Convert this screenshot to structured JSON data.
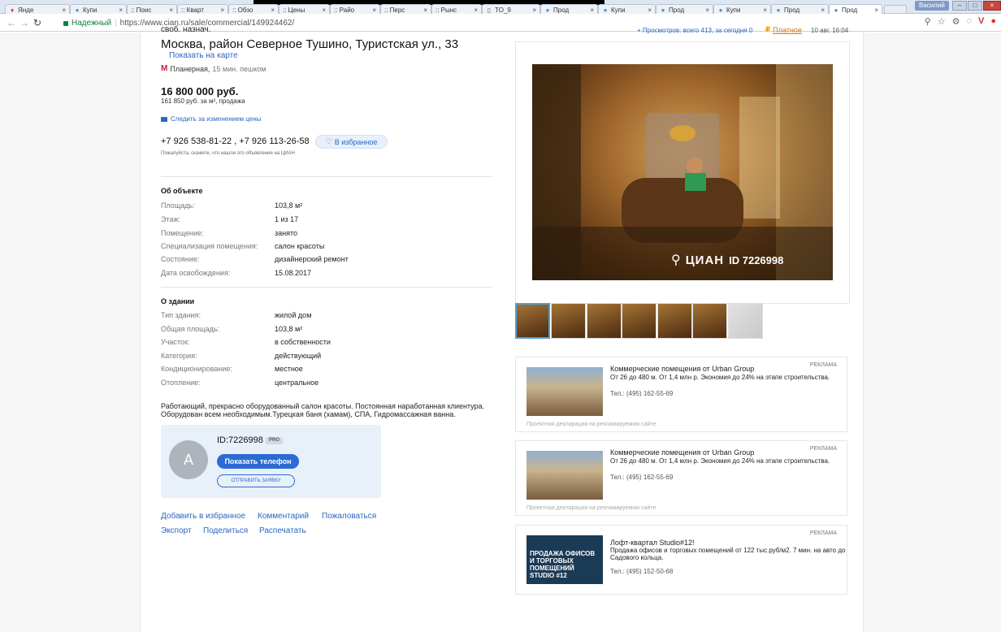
{
  "browser": {
    "tabs": [
      {
        "label": "Янде",
        "icon": "yandex-icon"
      },
      {
        "label": "Купи",
        "icon": "cian-pin-icon"
      },
      {
        "label": ":: Поис",
        "icon": "page-icon"
      },
      {
        "label": ":: Кварт",
        "icon": "page-icon"
      },
      {
        "label": ":: Обзо",
        "icon": "page-icon"
      },
      {
        "label": ":: Цены",
        "icon": "page-icon"
      },
      {
        "label": ":: Райо",
        "icon": "page-icon"
      },
      {
        "label": ":: Перс",
        "icon": "page-icon"
      },
      {
        "label": ":: Рынс",
        "icon": "page-icon"
      },
      {
        "label": "TO_9",
        "icon": "document-icon"
      },
      {
        "label": "Прод",
        "icon": "cian-pin-icon"
      },
      {
        "label": "Купи",
        "icon": "cian-pin-icon"
      },
      {
        "label": "Прод",
        "icon": "cian-pin-icon"
      },
      {
        "label": "Купи",
        "icon": "cian-pin-icon"
      },
      {
        "label": "Прод",
        "icon": "cian-pin-icon"
      },
      {
        "label": "Прод",
        "icon": "cian-pin-icon",
        "active": true
      }
    ],
    "tab_close": "×",
    "user_name": "Василий",
    "secure_label": "Надежный",
    "url": "https://www.cian.ru/sale/commercial/149924462/"
  },
  "listing": {
    "type_label": "своб. назнач.",
    "address": "Москва, район Северное Тушино, Туристская ул., 33",
    "map_link": "Показать на карте",
    "metro_station": "Планерная,",
    "metro_walk": "15 мин. пешком",
    "price": "16 800 000 руб.",
    "price_sub": "161 850 руб. за м², продажа",
    "follow_price": "Следить за изменением цены",
    "phones": "+7 926 538-81-22 , +7 926 113-26-58",
    "favorite_button": "В избранное",
    "note": "Пожалуйста, скажите, что нашли это объявление на ЦИАН",
    "object_title": "Об объекте",
    "object_rows": [
      {
        "label": "Площадь:",
        "value": "103,8 м²"
      },
      {
        "label": "Этаж:",
        "value": "1 из 17"
      },
      {
        "label": "Помещение:",
        "value": "занято"
      },
      {
        "label": "Специализация помещения:",
        "value": "салон красоты"
      },
      {
        "label": "Состояние:",
        "value": "дизайнерский ремонт"
      },
      {
        "label": "Дата освобождения:",
        "value": "15.08.2017"
      }
    ],
    "building_title": "О здании",
    "building_rows": [
      {
        "label": "Тип здания:",
        "value": "жилой дом"
      },
      {
        "label": "Общая площадь:",
        "value": "103,8 м²"
      },
      {
        "label": "Участок:",
        "value": "в собственности"
      },
      {
        "label": "Категория:",
        "value": "действующий"
      },
      {
        "label": "Кондиционирование:",
        "value": "местное"
      },
      {
        "label": "Отопление:",
        "value": "центральное"
      }
    ],
    "description": "Работающий, прекрасно оборудованный салон красоты. Постоянная наработанная клиентура. Оборудован всем необходимым.Турецкая баня (хамам), СПА, Гидромассажная ванна."
  },
  "agent": {
    "avatar_letter": "A",
    "id": "ID:7226998",
    "pro_badge": "PRO",
    "show_phone": "Показать телефон",
    "send_request": "ОТПРАВИТЬ ЗАЯВКУ"
  },
  "bottom_links": {
    "add_favorite": "Добавить в избранное",
    "comment": "Комментарий",
    "complain": "Пожаловаться",
    "export": "Экспорт",
    "share": "Поделиться",
    "print": "Распечатать"
  },
  "meta": {
    "views": "+ Просмотров: всего 413, за сегодня 0",
    "paid_label": "Платное",
    "date": "10 авг, 16:04"
  },
  "photo": {
    "watermark_brand": "ЦИАН",
    "watermark_id": "ID 7226998",
    "thumb_count": 7
  },
  "ads": [
    {
      "tag": "РЕКЛАМА",
      "title": "Коммерческие помещения от Urban Group",
      "desc": "От 26 до 480 м. От 1,4 млн р. Экономия до 24% на этапе строительства.",
      "tel": "Тел.: (495) 162-55-69",
      "footer": "Проектная декларация на рекламируемом сайте"
    },
    {
      "tag": "РЕКЛАМА",
      "title": "Коммерческие помещения от Urban Group",
      "desc": "От 26 до 480 м. От 1,4 млн р. Экономия до 24% на этапе строительства.",
      "tel": "Тел.: (495) 162-55-69",
      "footer": "Проектная декларация на рекламируемом сайте"
    },
    {
      "tag": "РЕКЛАМА",
      "title": "Лофт-квартал Studio#12!",
      "desc": "Продажа офисов и торговых помещений от 122 тыс.руб/м2. 7 мин. на авто до Садового кольца.",
      "tel": "Тел.: (495) 152-50-68",
      "image_text": "ПРОДАЖА ОФИСОВ И ТОРГОВЫХ ПОМЕЩЕНИЙ STUDIO #12"
    }
  ]
}
